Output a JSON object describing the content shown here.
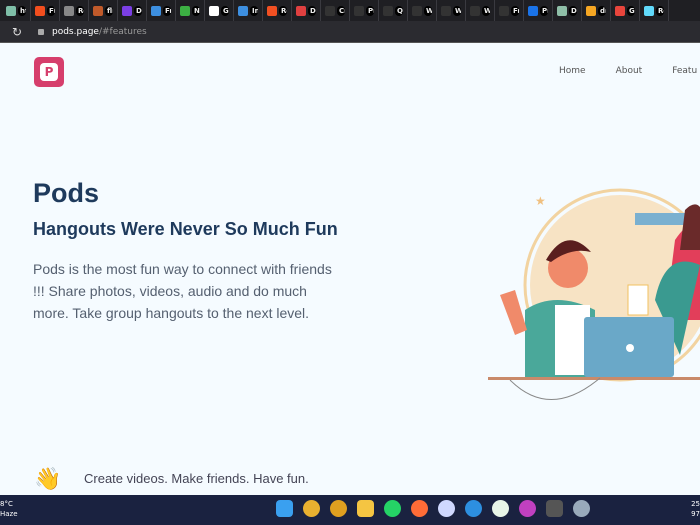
{
  "browser": {
    "tabs": [
      {
        "label": "ht",
        "color": "#7fbfa8"
      },
      {
        "label": "Fi",
        "color": "#f24e1e"
      },
      {
        "label": "Re",
        "color": "#888"
      },
      {
        "label": "fli",
        "color": "#c05a2a"
      },
      {
        "label": "D",
        "color": "#7b3fe4"
      },
      {
        "label": "Fr",
        "color": "#3d8fe0"
      },
      {
        "label": "N",
        "color": "#3cb043"
      },
      {
        "label": "G",
        "color": "#fff"
      },
      {
        "label": "In",
        "color": "#3d8fe0"
      },
      {
        "label": "Re",
        "color": "#f25022"
      },
      {
        "label": "D",
        "color": "#e04040"
      },
      {
        "label": "Cr",
        "color": "#333"
      },
      {
        "label": "Pr",
        "color": "#333"
      },
      {
        "label": "Q",
        "color": "#333"
      },
      {
        "label": "W",
        "color": "#333"
      },
      {
        "label": "W",
        "color": "#333"
      },
      {
        "label": "W",
        "color": "#333"
      },
      {
        "label": "Fr",
        "color": "#333"
      },
      {
        "label": "Pr",
        "color": "#1a73e8"
      },
      {
        "label": "D",
        "color": "#8fbfa8"
      },
      {
        "label": "di",
        "color": "#f5a623"
      },
      {
        "label": "G",
        "color": "#e8453c"
      },
      {
        "label": "Re",
        "color": "#61dafb"
      }
    ],
    "url_host": "pods.page",
    "url_path": "/#features"
  },
  "site": {
    "logo_letter": "P",
    "nav": [
      "Home",
      "About",
      "Featu"
    ],
    "title": "Pods",
    "subtitle": "Hangouts Were Never So Much Fun",
    "description": "Pods is the most fun way to connect with friends !!! Share photos, videos, audio and do much more. Take group hangouts to the next level.",
    "tagline": "Create videos. Make friends. Have fun.",
    "wave_emoji": "👋"
  },
  "taskbar": {
    "weather_temp": "8°C",
    "weather_desc": "Haze",
    "clock_line1": "25",
    "clock_line2": "97",
    "apps": [
      {
        "name": "start",
        "color": "#3aa0f0"
      },
      {
        "name": "chrome",
        "color": "#e8b030"
      },
      {
        "name": "chrome-canary",
        "color": "#e0a020"
      },
      {
        "name": "file-explorer",
        "color": "#f5c542"
      },
      {
        "name": "whatsapp",
        "color": "#25d366"
      },
      {
        "name": "postman",
        "color": "#ff6c37"
      },
      {
        "name": "app-store",
        "color": "#cfd8ff"
      },
      {
        "name": "vscode",
        "color": "#2d8fe0"
      },
      {
        "name": "mongodb",
        "color": "#e8f5e8"
      },
      {
        "name": "intellij",
        "color": "#c040c0"
      },
      {
        "name": "terminal",
        "color": "#555"
      },
      {
        "name": "utility",
        "color": "#9ab"
      }
    ]
  }
}
